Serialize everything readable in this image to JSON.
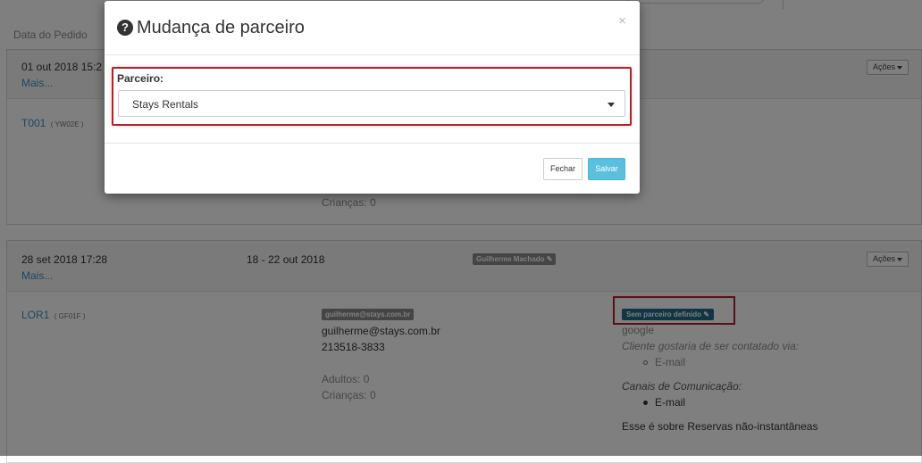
{
  "list": {
    "col_header": "Data do Pedido",
    "orders": [
      {
        "date": "01 out 2018 15:2",
        "more": "Mais...",
        "actions": "Ações",
        "booking_id": "T001",
        "booking_code": "( YW02E )",
        "children": "Crianças: 0"
      },
      {
        "date": "28 set 2018 17:28",
        "more": "Mais...",
        "period": "18 - 22 out 2018",
        "agent": "Guilherme Machado",
        "actions": "Ações",
        "booking_id": "LOR1",
        "booking_code": "( GF01F )",
        "email_tag": "guilherme@stays.com.br",
        "email": "guilherme@stays.com.br",
        "phone": "213518-3833",
        "adults": "Adultos: 0",
        "children": "Crianças: 0",
        "partner_badge": "Sem parceiro definido",
        "source": "google",
        "contact_pref_label": "Cliente gostaria de ser contatado via:",
        "contact_pref_item": "E-mail",
        "channels_label": "Canais de Comunicação:",
        "channels_item": "E-mail",
        "note": "Esse é sobre Reservas não-instantâneas"
      }
    ]
  },
  "modal": {
    "title": "Mudança de parceiro",
    "close_glyph": "×",
    "field_label": "Parceiro:",
    "select_value": "Stays Rentals",
    "close_button": "Fechar",
    "save_button": "Salvar"
  },
  "colors": {
    "link": "#3a8fc6",
    "save_button": "#5bc0de",
    "highlight_box": "#b3202a",
    "partner_badge": "#1f6b8c"
  }
}
